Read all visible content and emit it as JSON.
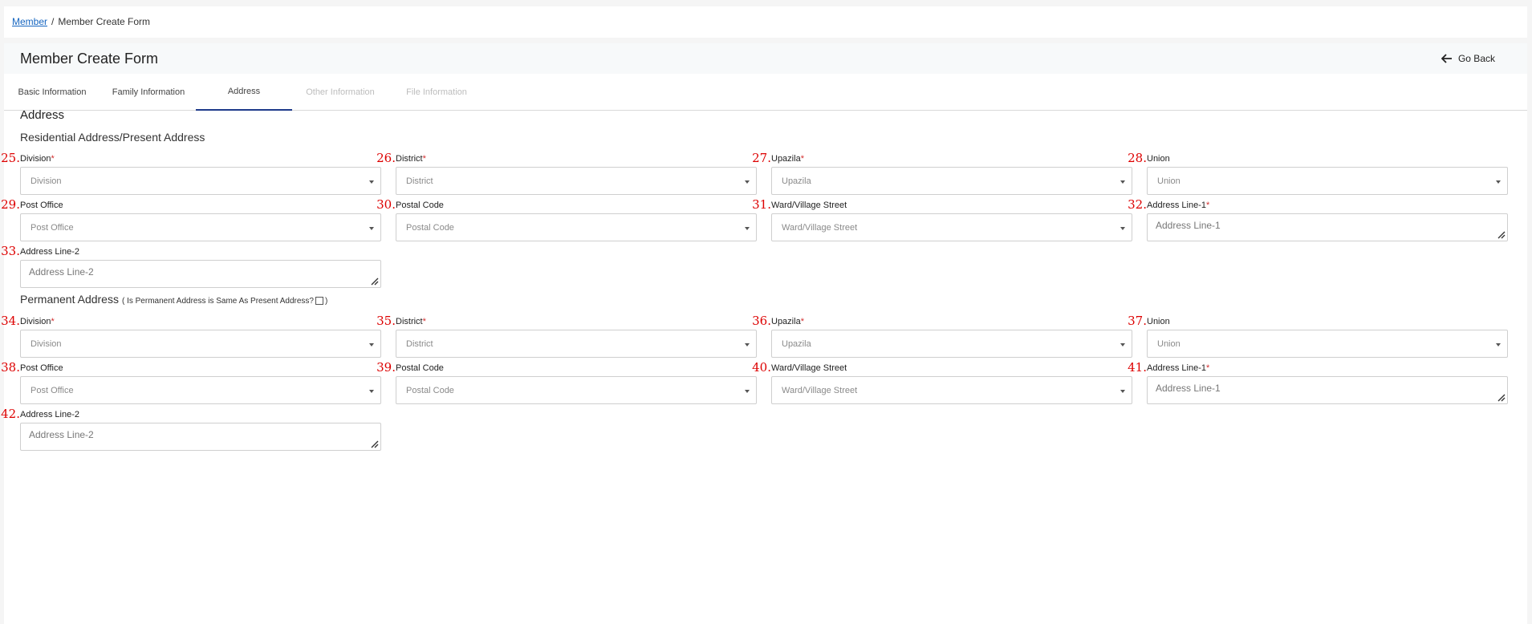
{
  "breadcrumb": {
    "link": "Member",
    "separator": "/",
    "current": "Member Create Form"
  },
  "header": {
    "title": "Member Create Form",
    "go_back": "Go Back"
  },
  "tabs": [
    {
      "label": "Basic Information",
      "state": "normal"
    },
    {
      "label": "Family Information",
      "state": "normal"
    },
    {
      "label": "Address",
      "state": "active"
    },
    {
      "label": "Other Information",
      "state": "disabled"
    },
    {
      "label": "File Information",
      "state": "disabled"
    }
  ],
  "section": {
    "title": "Address"
  },
  "present": {
    "title": "Residential Address/Present Address",
    "fields": [
      {
        "num": "25.",
        "label": "Division",
        "required": "*",
        "placeholder": "Division"
      },
      {
        "num": "26.",
        "label": "District",
        "required": "*",
        "placeholder": "District"
      },
      {
        "num": "27.",
        "label": "Upazila",
        "required": "*",
        "placeholder": "Upazila"
      },
      {
        "num": "28.",
        "label": "Union",
        "required": "",
        "placeholder": "Union"
      },
      {
        "num": "29.",
        "label": "Post Office",
        "required": "",
        "placeholder": "Post Office"
      },
      {
        "num": "30.",
        "label": "Postal Code",
        "required": "",
        "placeholder": "Postal Code"
      },
      {
        "num": "31.",
        "label": "Ward/Village Street",
        "required": "",
        "placeholder": "Ward/Village Street"
      },
      {
        "num": "32.",
        "label": "Address Line-1",
        "required": "*",
        "placeholder": "Address Line-1"
      },
      {
        "num": "33.",
        "label": "Address Line-2",
        "required": "",
        "placeholder": "Address Line-2"
      }
    ]
  },
  "permanent": {
    "title": "Permanent Address",
    "note_prefix": "( Is Permanent Address is Same As Present Address?",
    "note_suffix": ")",
    "fields": [
      {
        "num": "34.",
        "label": "Division",
        "required": "*",
        "placeholder": "Division"
      },
      {
        "num": "35.",
        "label": "District",
        "required": "*",
        "placeholder": "District"
      },
      {
        "num": "36.",
        "label": "Upazila",
        "required": "*",
        "placeholder": "Upazila"
      },
      {
        "num": "37.",
        "label": "Union",
        "required": "",
        "placeholder": "Union"
      },
      {
        "num": "38.",
        "label": "Post Office",
        "required": "",
        "placeholder": "Post Office"
      },
      {
        "num": "39.",
        "label": "Postal Code",
        "required": "",
        "placeholder": "Postal Code"
      },
      {
        "num": "40.",
        "label": "Ward/Village Street",
        "required": "",
        "placeholder": "Ward/Village Street"
      },
      {
        "num": "41.",
        "label": "Address Line-1",
        "required": "*",
        "placeholder": "Address Line-1"
      },
      {
        "num": "42.",
        "label": "Address Line-2",
        "required": "",
        "placeholder": "Address Line-2"
      }
    ]
  },
  "colors": {
    "link": "#1565c0",
    "required": "#d32f2f",
    "annotation": "#dd0000",
    "tab_active": "#1e3a8a"
  }
}
